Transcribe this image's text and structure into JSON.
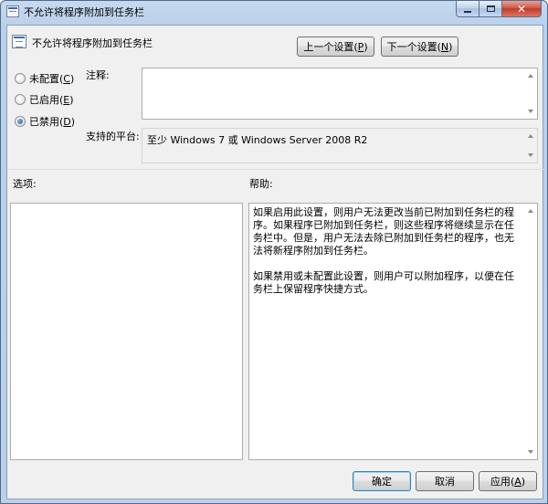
{
  "window": {
    "title": "不允许将程序附加到任务栏",
    "controls": {
      "minimize": "minimize",
      "maximize": "maximize",
      "close": "✕"
    }
  },
  "header": {
    "title": "不允许将程序附加到任务栏",
    "prev_label": "上一个设置",
    "prev_key": "P",
    "next_label": "下一个设置",
    "next_key": "N"
  },
  "state": {
    "options": [
      {
        "label": "未配置",
        "key": "C",
        "checked": false
      },
      {
        "label": "已启用",
        "key": "E",
        "checked": false
      },
      {
        "label": "已禁用",
        "key": "D",
        "checked": true
      }
    ]
  },
  "comment": {
    "label": "注释:",
    "value": ""
  },
  "platform": {
    "label": "支持的平台:",
    "value": "至少 Windows 7 或 Windows Server 2008 R2"
  },
  "options_section": {
    "label": "选项:"
  },
  "help_section": {
    "label": "帮助:",
    "paragraphs": [
      "如果启用此设置，则用户无法更改当前已附加到任务栏的程序。如果程序已附加到任务栏，则这些程序将继续显示在任务栏中。但是，用户无法去除已附加到任务栏的程序，也无法将新程序附加到任务栏。",
      "如果禁用或未配置此设置，则用户可以附加程序，以便在任务栏上保留程序快捷方式。"
    ]
  },
  "footer": {
    "ok_label": "确定",
    "cancel_label": "取消",
    "apply_label": "应用",
    "apply_key": "A"
  }
}
